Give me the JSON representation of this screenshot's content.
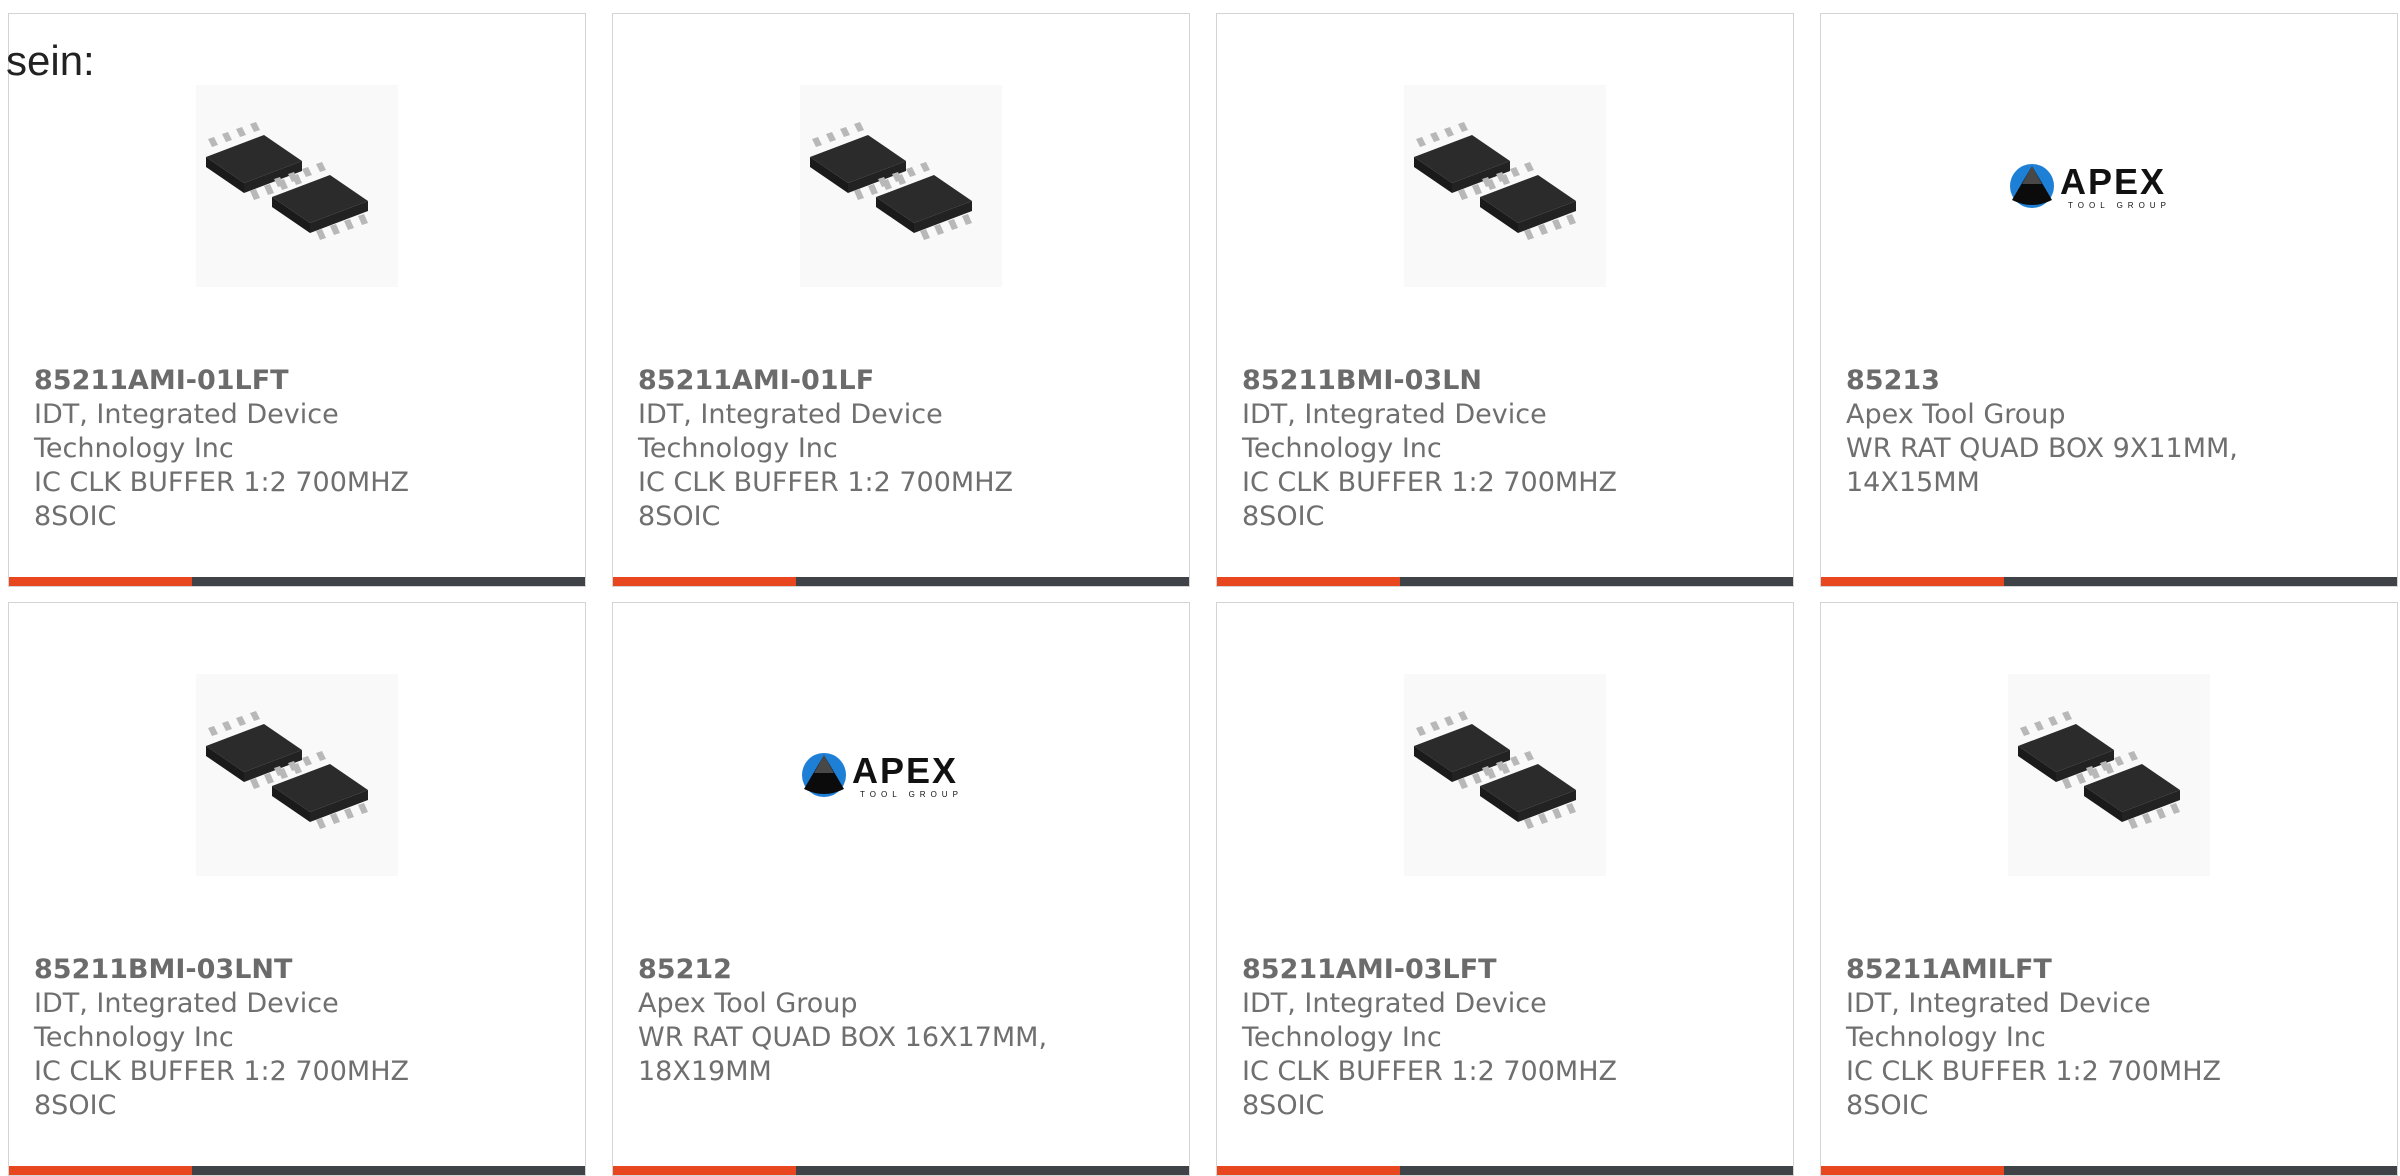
{
  "page": {
    "intro_text": "sein:",
    "colors": {
      "accent": "#e8461e",
      "bar": "#3f4347",
      "text": "#6f6f6f",
      "border": "#d4d4d4"
    }
  },
  "products": [
    {
      "part_number": "85211AMI-01LFT",
      "manufacturer": [
        "IDT, Integrated Device",
        "Technology Inc"
      ],
      "description": [
        "IC CLK BUFFER 1:2 700MHZ",
        "8SOIC"
      ],
      "image": "soic-chip-image"
    },
    {
      "part_number": "85211AMI-01LF",
      "manufacturer": [
        "IDT, Integrated Device",
        "Technology Inc"
      ],
      "description": [
        "IC CLK BUFFER 1:2 700MHZ",
        "8SOIC"
      ],
      "image": "soic-chip-image"
    },
    {
      "part_number": "85211BMI-03LN",
      "manufacturer": [
        "IDT, Integrated Device",
        "Technology Inc"
      ],
      "description": [
        "IC CLK BUFFER 1:2 700MHZ",
        "8SOIC"
      ],
      "image": "soic-chip-image"
    },
    {
      "part_number": "85213",
      "manufacturer": [
        "Apex Tool Group"
      ],
      "description": [
        "WR RAT QUAD BOX 9X11MM,",
        "14X15MM"
      ],
      "image": "apex-logo",
      "logo_text": "APEX",
      "logo_subtext": "TOOL GROUP"
    },
    {
      "part_number": "85211BMI-03LNT",
      "manufacturer": [
        "IDT, Integrated Device",
        "Technology Inc"
      ],
      "description": [
        "IC CLK BUFFER 1:2 700MHZ",
        "8SOIC"
      ],
      "image": "soic-chip-image"
    },
    {
      "part_number": "85212",
      "manufacturer": [
        "Apex Tool Group"
      ],
      "description": [
        "WR RAT QUAD BOX 16X17MM,",
        "18X19MM"
      ],
      "image": "apex-logo",
      "logo_text": "APEX",
      "logo_subtext": "TOOL GROUP"
    },
    {
      "part_number": "85211AMI-03LFT",
      "manufacturer": [
        "IDT, Integrated Device",
        "Technology Inc"
      ],
      "description": [
        "IC CLK BUFFER 1:2 700MHZ",
        "8SOIC"
      ],
      "image": "soic-chip-image"
    },
    {
      "part_number": "85211AMILFT",
      "manufacturer": [
        "IDT, Integrated Device",
        "Technology Inc"
      ],
      "description": [
        "IC CLK BUFFER 1:2 700MHZ",
        "8SOIC"
      ],
      "image": "soic-chip-image"
    }
  ]
}
